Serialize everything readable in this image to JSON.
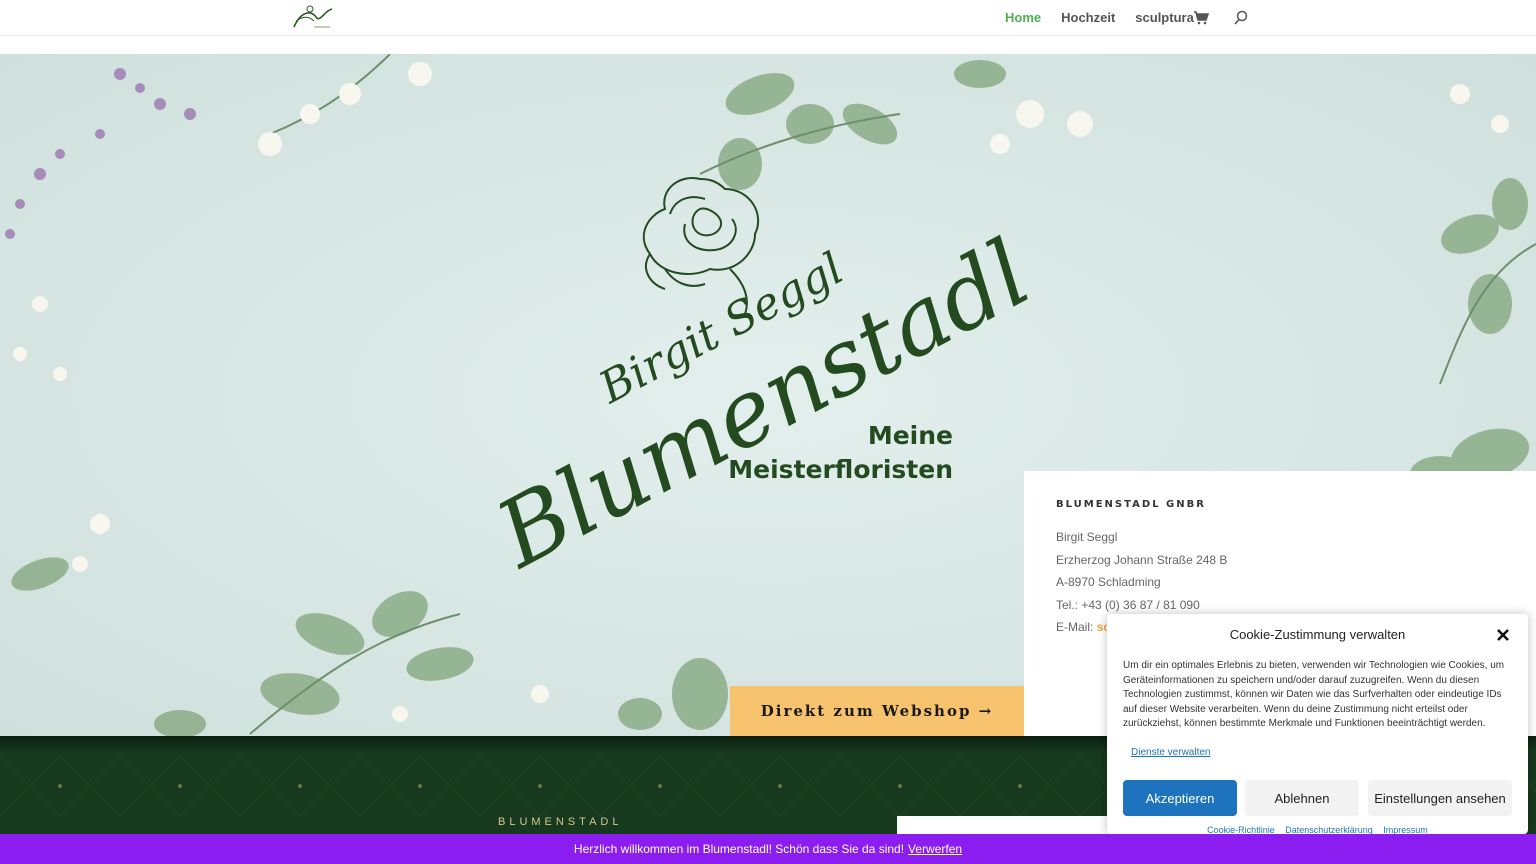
{
  "header": {
    "logo_alt": "Birgit Seggl Blumenstadl",
    "nav": [
      {
        "label": "Home",
        "active": true
      },
      {
        "label": "Hochzeit",
        "active": false
      },
      {
        "label": "sculptura",
        "active": false
      }
    ],
    "cart_icon": "shopping-cart-icon",
    "search_icon": "search-icon",
    "accent_color": "#4caf50"
  },
  "hero": {
    "brand_name": "Birgit Seggl",
    "brand_script": "Blumenstadl",
    "tagline_1": "Meine",
    "tagline_2": "Meisterfloristen",
    "webshop_button": "Direkt zum Webshop →",
    "button_color": "#f7c36f",
    "brand_color": "#244a1f"
  },
  "contact": {
    "title": "BLUMENSTADL GNBR",
    "lines": [
      "Birgit Seggl",
      "Erzherzog Johann Straße 248 B",
      "A-8970 Schladming",
      "Tel.: +43 (0) 36 87 / 81 090"
    ],
    "email_label": "E-Mail:",
    "email_value": "sc"
  },
  "section": {
    "label": "BLUMENSTADL",
    "bg_color": "#17391d"
  },
  "cookie": {
    "title": "Cookie-Zustimmung verwalten",
    "text": "Um dir ein optimales Erlebnis zu bieten, verwenden wir Technologien wie Cookies, um Geräteinformationen zu speichern und/oder darauf zuzugreifen. Wenn du diesen Technologien zustimmst, können wir Daten wie das Surfverhalten oder eindeutige IDs auf dieser Website verarbeiten. Wenn du deine Zustimmung nicht erteilst oder zurückziehst, können bestimmte Merkmale und Funktionen beeinträchtigt werden.",
    "manage_link": "Dienste verwalten",
    "accept": "Akzeptieren",
    "deny": "Ablehnen",
    "settings": "Einstellungen ansehen",
    "links": [
      "Cookie-Richtlinie",
      "Datenschutzerklärung",
      "Impressum"
    ],
    "accent_color": "#1e73be"
  },
  "notice": {
    "text": "Herzlich willkommen im Blumenstadl! Schön dass Sie da sind!",
    "dismiss": "Verwerfen",
    "bg_color": "#8b1df0"
  }
}
